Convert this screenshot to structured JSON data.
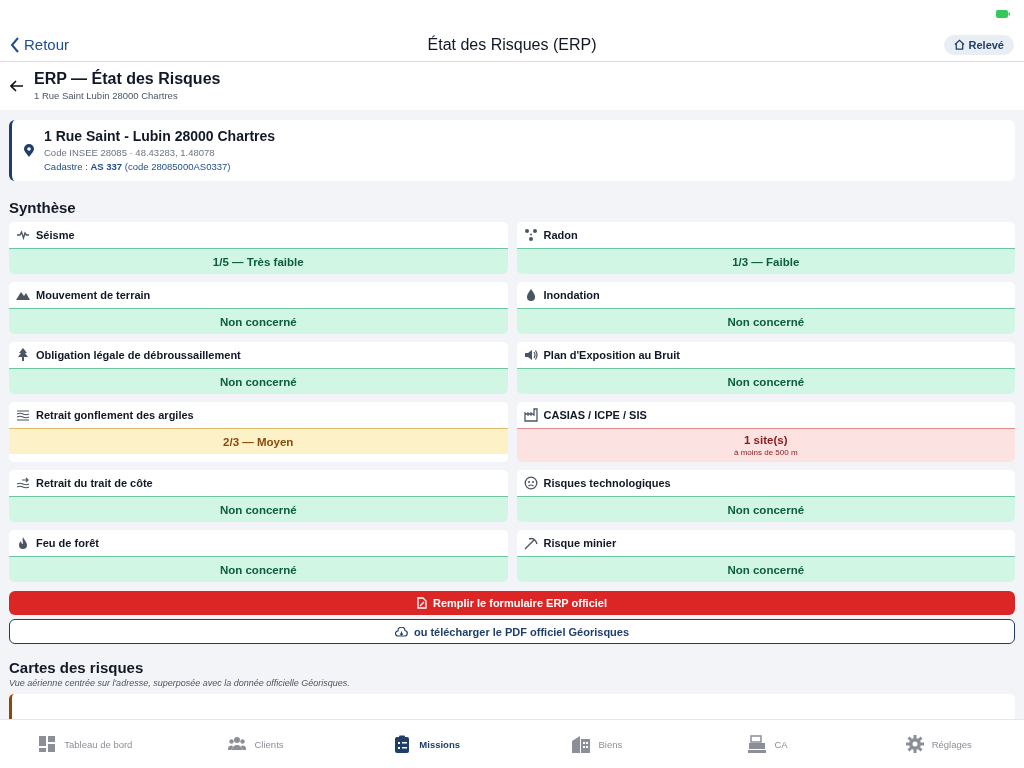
{
  "nav": {
    "back": "Retour",
    "title": "État des Risques (ERP)",
    "action": "Relevé"
  },
  "page_header": {
    "title": "ERP — État des Risques",
    "subtitle": "1 Rue Saint Lubin 28000 Chartres"
  },
  "address": {
    "title": "1 Rue Saint - Lubin 28000 Chartres",
    "insee": "Code INSEE 28085 · 48.43283, 1.48078",
    "cadastre": "Cadastre : **AS 337** (code 28085000AS0337)"
  },
  "synthese": {
    "heading": "Synthèse",
    "risks": [
      {
        "label": "Séisme",
        "value": "1/5 — Très faible",
        "kind": "ok"
      },
      {
        "label": "Radon",
        "value": "1/3 — Faible",
        "kind": "ok"
      },
      {
        "label": "Mouvement de terrain",
        "value": "Non concerné",
        "kind": "ok"
      },
      {
        "label": "Inondation",
        "value": "Non concerné",
        "kind": "ok"
      },
      {
        "label": "Obligation légale de débroussaillement",
        "value": "Non concerné",
        "kind": "ok"
      },
      {
        "label": "Plan d'Exposition au Bruit",
        "value": "Non concerné",
        "kind": "ok"
      },
      {
        "label": "Retrait gonflement des argiles",
        "value": "2/3 — Moyen",
        "kind": "medium"
      },
      {
        "label": "CASIAS / ICPE / SIS",
        "value": "1 site(s)",
        "note": "à moins de 500 m",
        "kind": "alert"
      },
      {
        "label": "Retrait du trait de côte",
        "value": "Non concerné",
        "kind": "ok"
      },
      {
        "label": "Risques technologiques",
        "value": "Non concerné",
        "kind": "ok"
      },
      {
        "label": "Feu de forêt",
        "value": "Non concerné",
        "kind": "ok"
      },
      {
        "label": "Risque minier",
        "value": "Non concerné",
        "kind": "ok"
      }
    ]
  },
  "primary_button": "Remplir le formulaire ERP officiel",
  "secondary_button": "ou télécharger le PDF officiel Géorisques",
  "maps": {
    "heading": "Cartes des risques",
    "subtitle": "Vue aérienne centrée sur l'adresse, superposée avec la donnée officielle Géorisques."
  },
  "tabs": [
    {
      "label": "Tableau de bord",
      "selected": false
    },
    {
      "label": "Clients",
      "selected": false
    },
    {
      "label": "Missions",
      "selected": true
    },
    {
      "label": "Biens",
      "selected": false
    },
    {
      "label": "CA",
      "selected": false
    },
    {
      "label": "Réglages",
      "selected": false
    }
  ]
}
